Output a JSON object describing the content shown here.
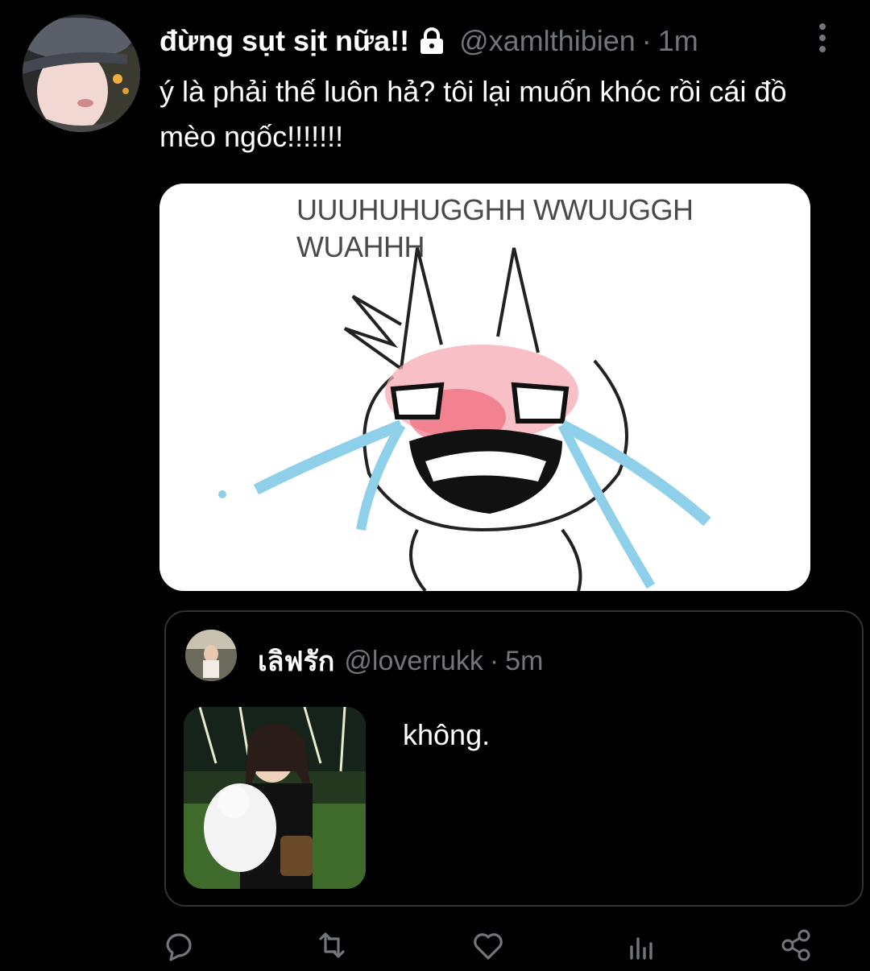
{
  "tweet": {
    "display_name": "đừng sụt sịt nữa!!",
    "handle": "@xamlthibien",
    "separator": "·",
    "time": "1m",
    "text": "ý là phải thế luôn hả? tôi lại muốn khóc rồi cái đồ mèo ngốc!!!!!!!",
    "media_caption_line1": "UUUHUHUGGHH WWUUGGH",
    "media_caption_line2": "WUAHHH"
  },
  "quoted_tweet": {
    "display_name": "เลิฟรัก",
    "handle": "@loverrukk",
    "separator": "·",
    "time": "5m",
    "text": "không."
  },
  "icons": {
    "lock": "lock-icon",
    "more": "more-vertical-icon",
    "reply": "reply-icon",
    "retweet": "retweet-icon",
    "like": "heart-icon",
    "views": "views-icon",
    "share": "share-icon"
  },
  "colors": {
    "background": "#000000",
    "text": "#ffffff",
    "muted": "#71767b",
    "border": "#2f3336"
  }
}
